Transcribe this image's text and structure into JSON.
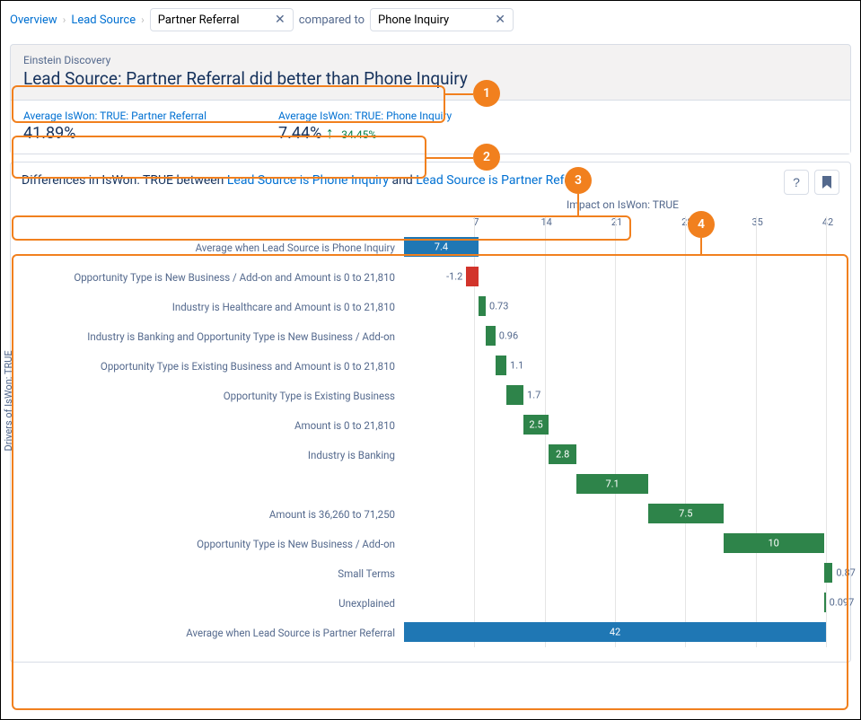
{
  "breadcrumb": {
    "overview": "Overview",
    "lead_source": "Lead Source",
    "pill1": "Partner Referral",
    "compared_to": "compared to",
    "pill2": "Phone Inquiry"
  },
  "callouts": {
    "c1": "1",
    "c2": "2",
    "c3": "3",
    "c4": "4"
  },
  "summary": {
    "label": "Einstein Discovery",
    "title": "Lead Source: Partner Referral did better than Phone Inquiry",
    "stat1_label": "Average IsWon: TRUE: Partner Referral",
    "stat1_value": "41.89%",
    "stat2_label": "Average IsWon: TRUE: Phone Inquiry",
    "stat2_value": "7.44%",
    "delta_arrow": "↑",
    "delta": "34.45%"
  },
  "diff": {
    "prefix": "Differences in IsWon: TRUE between ",
    "link1": "Lead Source is Phone Inquiry",
    "mid": " and ",
    "link2": "Lead Source is Partner Referral",
    "help": "?",
    "bookmark": "🔖"
  },
  "chart_data": {
    "type": "bar",
    "title": "Impact on IsWon: TRUE",
    "ylabel": "Drivers of IsWon: TRUE",
    "xticks": [
      7,
      14,
      21,
      28,
      35,
      42
    ],
    "xlim": [
      0,
      42
    ],
    "rows": [
      {
        "label": "Average when Lead Source is Phone Inquiry",
        "start": 0,
        "value": 7.4,
        "color": "blue",
        "label_pos": "inside"
      },
      {
        "label": "Opportunity Type is New Business / Add-on and Amount is 0 to 21,810",
        "start": 7.4,
        "value": -1.2,
        "color": "red",
        "label_pos": "left"
      },
      {
        "label": "Industry is Healthcare and Amount is 0 to 21,810",
        "start": 7.4,
        "value": 0.73,
        "color": "green",
        "label_pos": "right"
      },
      {
        "label": "Industry is Banking and Opportunity Type is New Business / Add-on",
        "start": 8.13,
        "value": 0.96,
        "color": "green",
        "label_pos": "right"
      },
      {
        "label": "Opportunity Type is Existing Business and Amount is 0 to 21,810",
        "start": 9.09,
        "value": 1.1,
        "color": "green",
        "label_pos": "right"
      },
      {
        "label": "Opportunity Type is Existing Business",
        "start": 10.19,
        "value": 1.7,
        "color": "green",
        "label_pos": "right"
      },
      {
        "label": "Amount is 0 to 21,810",
        "start": 11.89,
        "value": 2.5,
        "color": "green",
        "label_pos": "inside"
      },
      {
        "label": "Industry is Banking",
        "start": 14.39,
        "value": 2.8,
        "color": "green",
        "label_pos": "inside"
      },
      {
        "label": "",
        "start": 17.19,
        "value": 7.1,
        "color": "green",
        "label_pos": "inside"
      },
      {
        "label": "Amount is 36,260 to 71,250",
        "start": 24.29,
        "value": 7.5,
        "color": "green",
        "label_pos": "inside"
      },
      {
        "label": "Opportunity Type is New Business / Add-on",
        "start": 31.79,
        "value": 10,
        "color": "green",
        "label_pos": "inside"
      },
      {
        "label": "Small Terms",
        "start": 41.79,
        "value": 0.87,
        "color": "green",
        "label_pos": "right"
      },
      {
        "label": "Unexplained",
        "start": 41.79,
        "value": 0.097,
        "color": "green",
        "label_pos": "right"
      },
      {
        "label": "Average when Lead Source is Partner Referral",
        "start": 0,
        "value": 42,
        "color": "blue",
        "label_pos": "inside"
      }
    ]
  }
}
